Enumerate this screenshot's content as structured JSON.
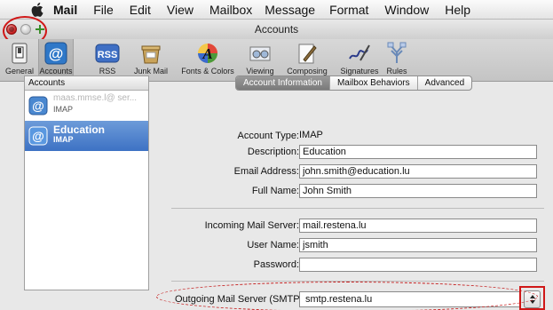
{
  "menubar": {
    "app": "Mail",
    "items": [
      "File",
      "Edit",
      "View",
      "Mailbox",
      "Message",
      "Format",
      "Window",
      "Help"
    ]
  },
  "window": {
    "title": "Accounts"
  },
  "toolbar": {
    "items": [
      {
        "label": "General",
        "icon": "switch-icon"
      },
      {
        "label": "Accounts",
        "icon": "at-sign-icon"
      },
      {
        "label": "RSS",
        "icon": "rss-icon"
      },
      {
        "label": "Junk Mail",
        "icon": "junk-mail-icon"
      },
      {
        "label": "Fonts & Colors",
        "icon": "font-colors-icon"
      },
      {
        "label": "Viewing",
        "icon": "viewing-icon"
      },
      {
        "label": "Composing",
        "icon": "composing-icon"
      },
      {
        "label": "Signatures",
        "icon": "signature-icon"
      },
      {
        "label": "Rules",
        "icon": "rules-icon"
      }
    ],
    "selected": "Accounts"
  },
  "accounts": {
    "header": "Accounts",
    "items": [
      {
        "name": "maas.mmse.l@ ser...",
        "type": "IMAP",
        "selected": false
      },
      {
        "name": "Education",
        "type": "IMAP",
        "selected": true
      }
    ]
  },
  "tabs": {
    "items": [
      "Account Information",
      "Mailbox Behaviors",
      "Advanced"
    ],
    "active": "Account Information"
  },
  "form": {
    "account_type_label": "Account Type:",
    "account_type_value": "IMAP",
    "description_label": "Description:",
    "description_value": "Education",
    "email_label": "Email Address:",
    "email_value": "john.smith@education.lu",
    "fullname_label": "Full Name:",
    "fullname_value": "John Smith",
    "incoming_label": "Incoming Mail Server:",
    "incoming_value": "mail.restena.lu",
    "username_label": "User Name:",
    "username_value": " jsmith",
    "password_label": "Password:",
    "password_value": "",
    "outgoing_label": "Outgoing Mail Server (SMTP):",
    "outgoing_value": "smtp.restena.lu"
  },
  "colors": {
    "selection": "#3d72c4",
    "highlight_annotation": "#d01818"
  }
}
